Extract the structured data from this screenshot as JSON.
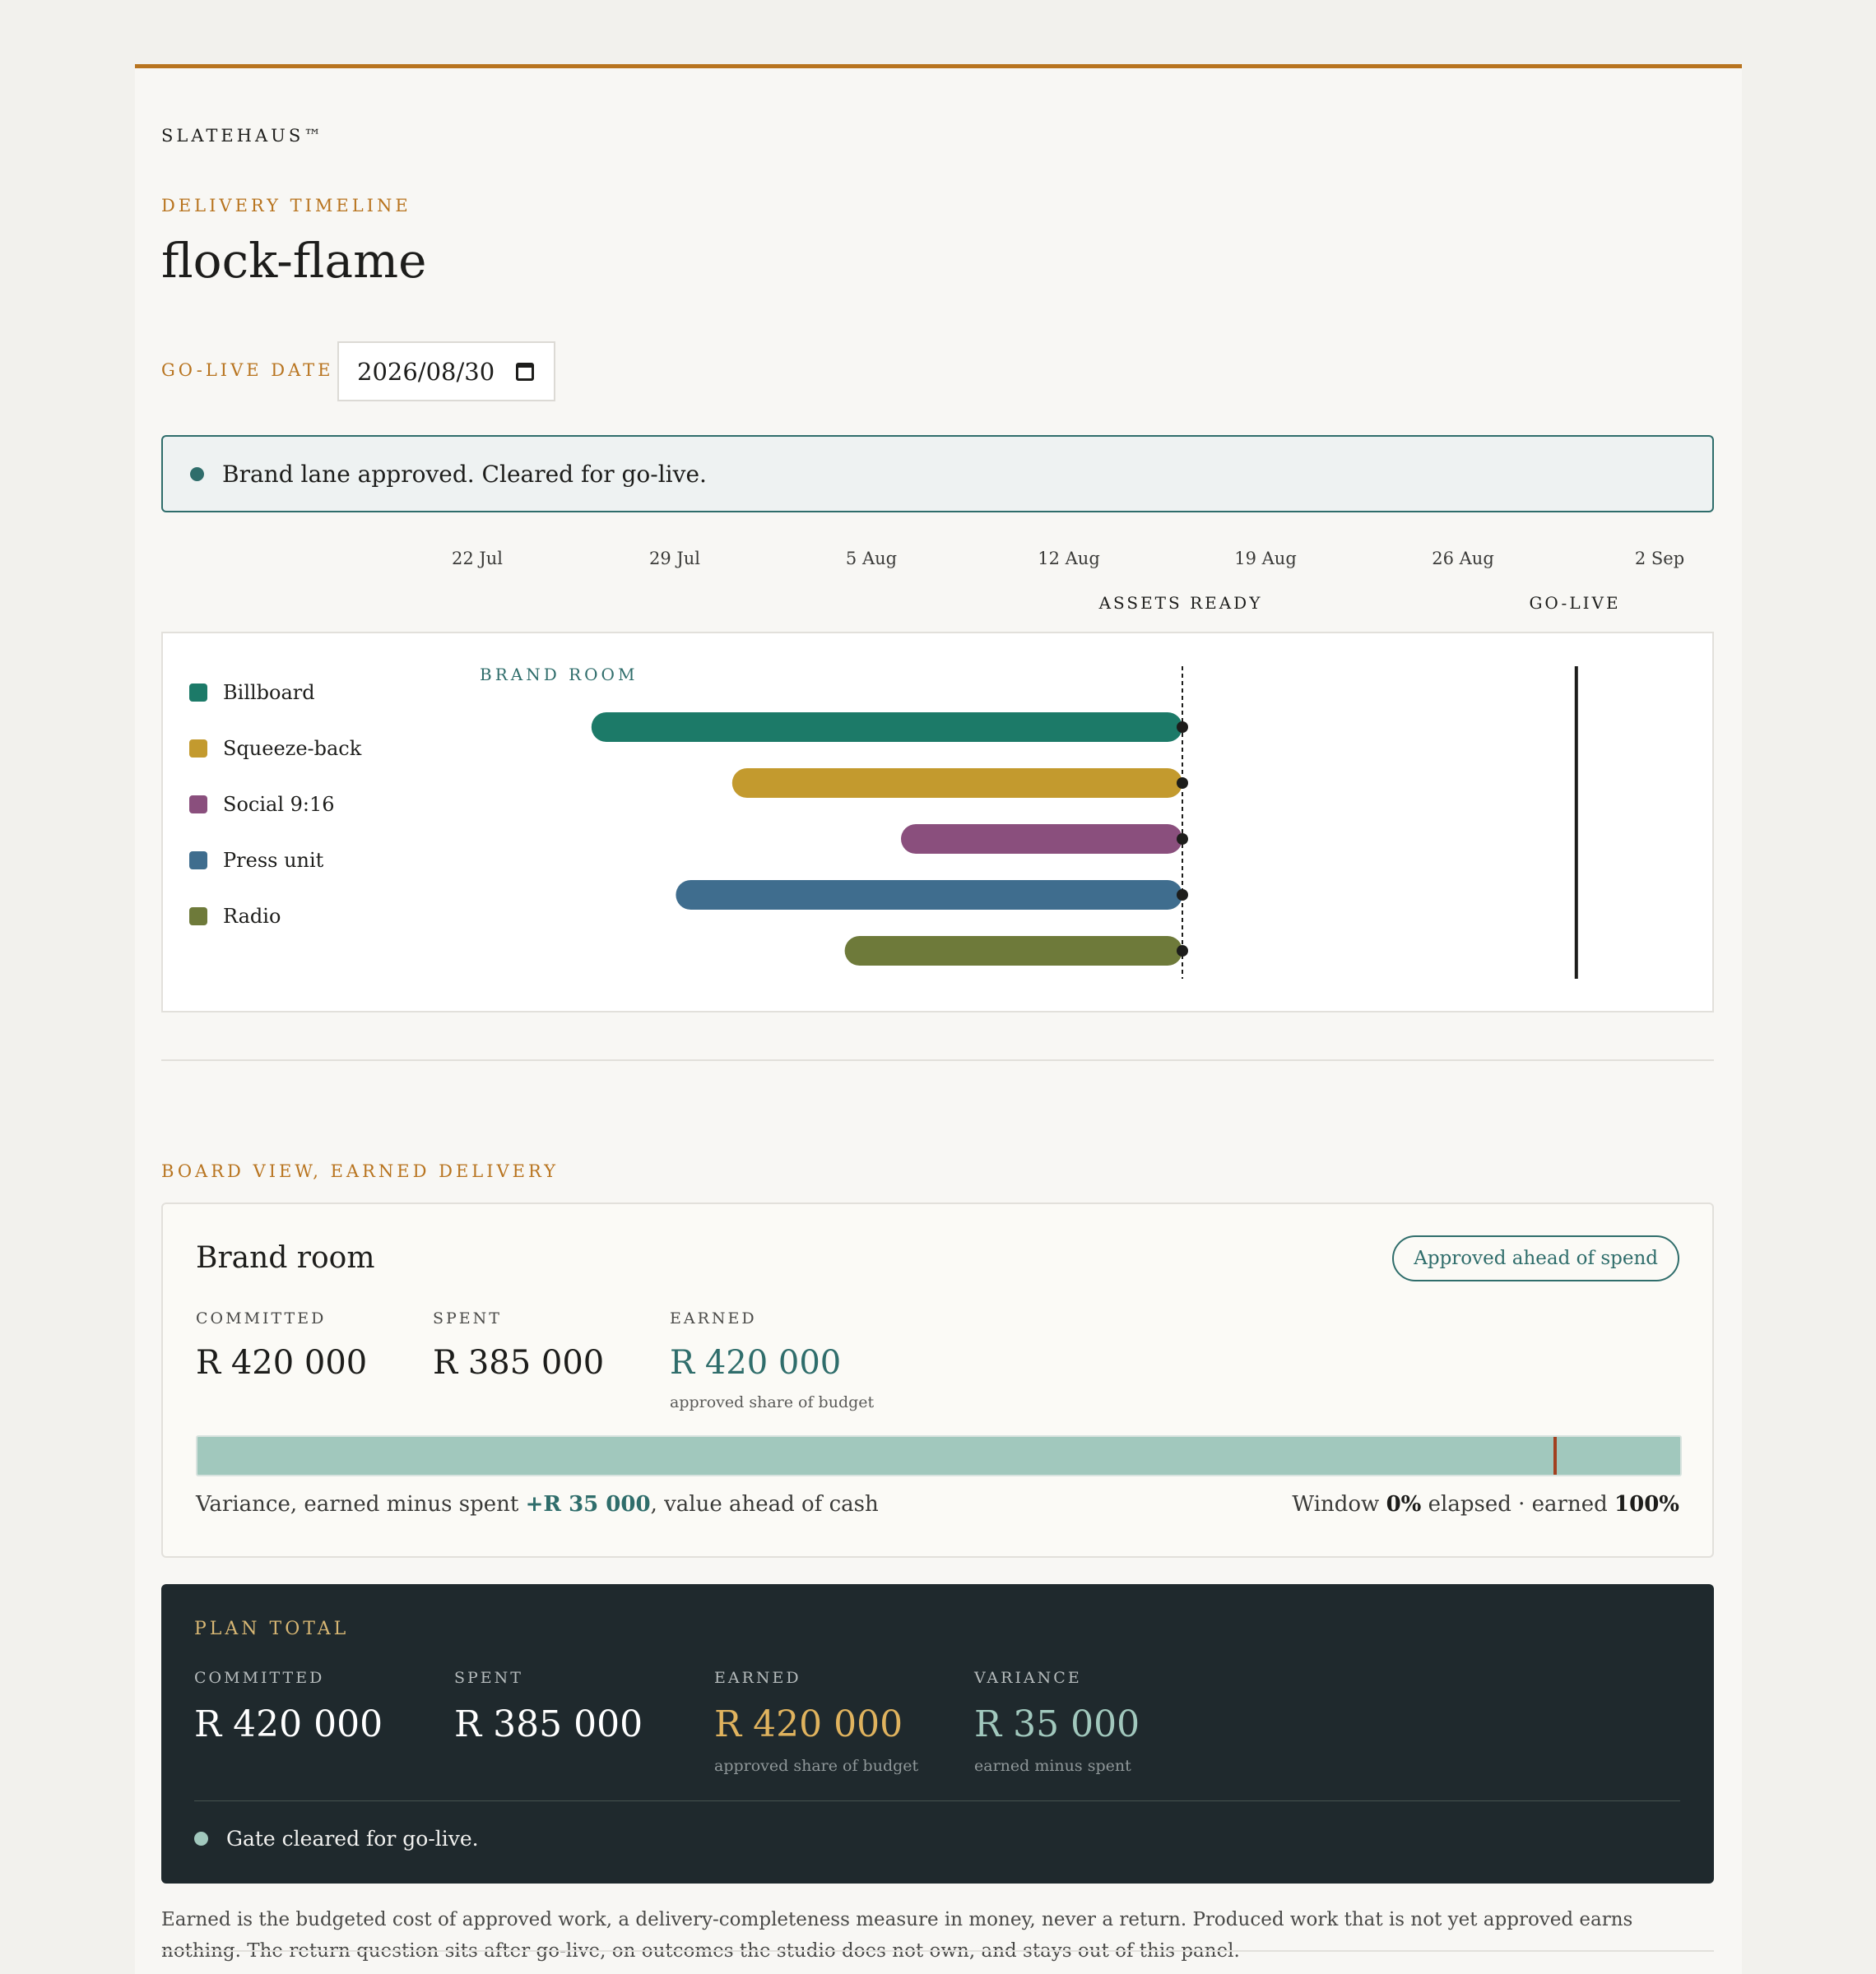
{
  "brand": "SLATEHAUS™",
  "eyebrow": "DELIVERY TIMELINE",
  "title": "flock-flame",
  "go_live": {
    "label": "GO-LIVE DATE",
    "value": "2026/08/30"
  },
  "alert": {
    "text": "Brand lane approved. Cleared for go-live."
  },
  "timeline": {
    "ticks": [
      "22 Jul",
      "29 Jul",
      "5 Aug",
      "12 Aug",
      "19 Aug",
      "26 Aug",
      "2 Sep"
    ],
    "milestones": {
      "assets_ready": "ASSETS READY",
      "go_live": "GO-LIVE"
    },
    "lane": "BRAND ROOM",
    "rows": [
      {
        "label": "Billboard",
        "start": "2026-07-26",
        "end": "2026-08-16",
        "color": "#1c7a68"
      },
      {
        "label": "Squeeze-back",
        "start": "2026-07-31",
        "end": "2026-08-16",
        "color": "#c39a2e"
      },
      {
        "label": "Social 9:16",
        "start": "2026-08-06",
        "end": "2026-08-16",
        "color": "#8a4f7d"
      },
      {
        "label": "Press unit",
        "start": "2026-07-29",
        "end": "2026-08-16",
        "color": "#3f6d8e"
      },
      {
        "label": "Radio",
        "start": "2026-08-04",
        "end": "2026-08-16",
        "color": "#6e7a3a"
      }
    ]
  },
  "board": {
    "section": "BOARD VIEW, EARNED DELIVERY",
    "card": {
      "name": "Brand room",
      "pill": "Approved ahead of spend",
      "committed_label": "COMMITTED",
      "committed": "R 420 000",
      "spent_label": "SPENT",
      "spent": "R 385 000",
      "earned_label": "EARNED",
      "earned": "R 420 000",
      "earned_sub": "approved share of budget",
      "variance_prefix": "Variance, earned minus spent",
      "variance_value": "+R 35 000",
      "variance_suffix": ", value ahead of cash",
      "window_prefix": "Window",
      "window_pct": "0%",
      "window_mid": "elapsed · earned",
      "earned_pct": "100%",
      "earned_fraction": 1.0,
      "spent_fraction": 0.9167,
      "colors": {
        "earned": "#2f6d6b",
        "bar": "#a1c8bd",
        "marker": "#a2401f"
      }
    }
  },
  "total": {
    "head": "PLAN TOTAL",
    "committed_label": "COMMITTED",
    "committed": "R 420 000",
    "spent_label": "SPENT",
    "spent": "R 385 000",
    "earned_label": "EARNED",
    "earned": "R 420 000",
    "earned_sub": "approved share of budget",
    "variance_label": "VARIANCE",
    "variance": "R 35 000",
    "variance_sub": "earned minus spent",
    "gate": "Gate cleared for go-live.",
    "colors": {
      "earned": "#e0b35e",
      "variance": "#a1c8bd"
    }
  },
  "note": "Earned is the budgeted cost of approved work, a delivery-completeness measure in money, never a return. Produced work that is not yet approved earns nothing. The return question sits after go-live, on outcomes the studio does not own, and stays out of this panel."
}
